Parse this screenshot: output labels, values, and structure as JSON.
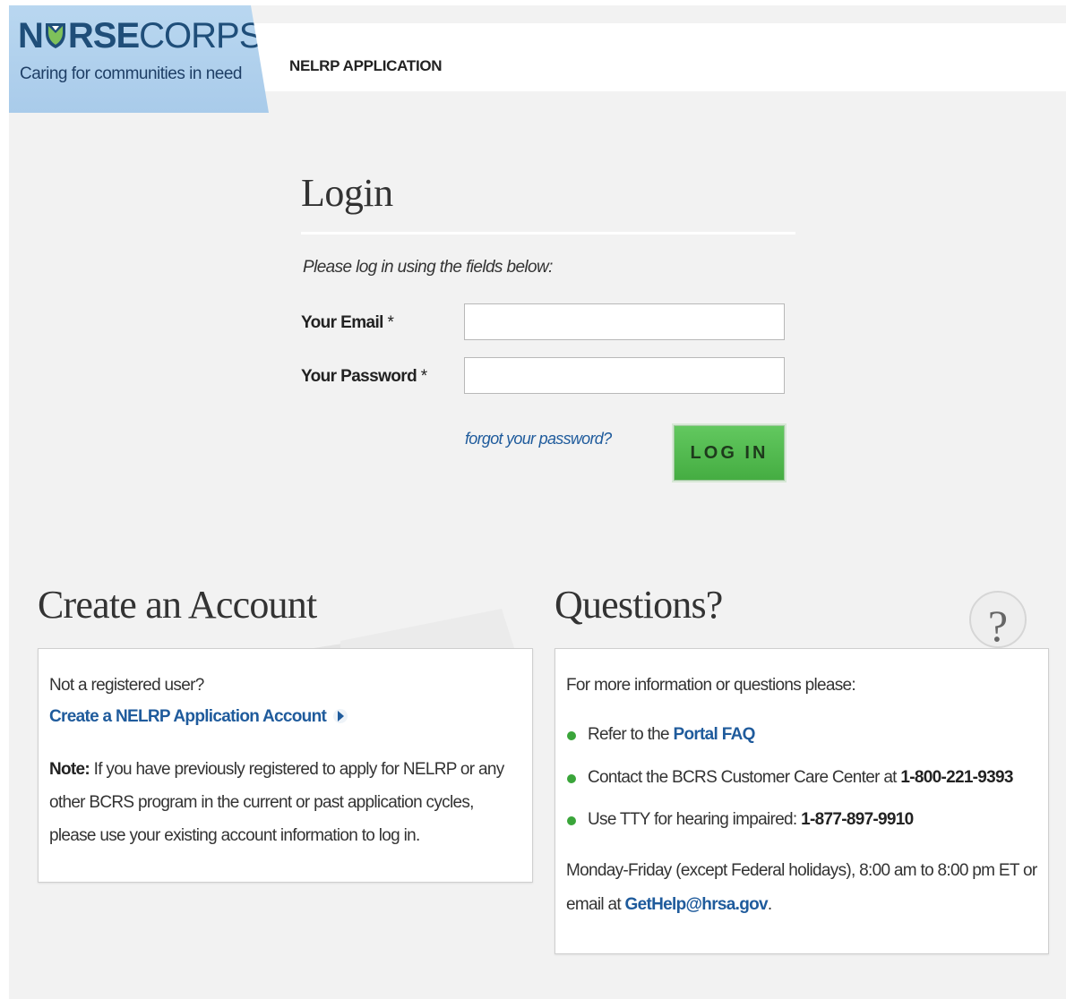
{
  "header": {
    "logo_word_bold_1": "N",
    "logo_word_bold_2": "RSE",
    "logo_word_light": "CORPS",
    "logo_tagline": "Caring for communities in need",
    "app_title": "NELRP APPLICATION",
    "brand_color": "#1f4e79"
  },
  "login": {
    "heading": "Login",
    "intro": "Please log in using the fields below:",
    "email_label": "Your Email",
    "password_label": "Your Password",
    "required_mark": "*",
    "email_value": "",
    "password_value": "",
    "forgot_link": "forgot your password?",
    "login_button": "LOG IN",
    "button_color": "#4fb84c"
  },
  "create_account": {
    "heading": "Create an Account",
    "prompt": "Not a registered user?",
    "link": "Create a NELRP Application Account",
    "note_label": "Note:",
    "note_text": "If you have previously registered to apply for NELRP or any other BCRS program in the current or past application cycles, please use your existing account information to log in."
  },
  "questions": {
    "heading": "Questions?",
    "intro": "For more information or questions please:",
    "item1_text": "Refer to the",
    "item1_link": "Portal FAQ",
    "item2_text": "Contact the BCRS Customer Care Center at",
    "item2_phone": "1-800-221-9393",
    "item3_text": "Use TTY for hearing impaired:",
    "item3_phone": "1-877-897-9910",
    "hours": "Monday-Friday (except Federal holidays), 8:00 am to 8:00 pm ET or",
    "email_prefix": "email at",
    "email_link": "GetHelp@hrsa.gov",
    "email_suffix": ".",
    "bullet_color": "#3aa53a"
  }
}
